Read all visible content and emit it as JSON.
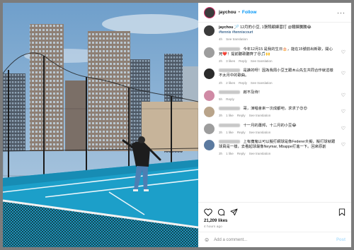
{
  "post": {
    "author": "jaychou",
    "follow_label": "Follow",
    "more_label": "···",
    "caption": "🏸 12月的小豆, 1張照顧練習打 @鐵鍊騰騰😂",
    "hashtag": "#tennis #tenniscourt",
    "caption_age": "4h",
    "see_translation": "See translation"
  },
  "comments": [
    {
      "text": "今年12月15 是我的生日🎂，能在15號前出新歌，開心死❤️！提前聽歌聽齊了😍🎵🙌",
      "age": "2h",
      "likes": "3 likes",
      "reply": "Reply",
      "translate": "See translation"
    },
    {
      "text": "是誰的呀！因為我周小豆王跟木山先生共同合作就這樣不太月中的歌曲。",
      "age": "2h",
      "likes": "2 likes",
      "reply": "Reply",
      "translate": "See translation"
    },
    {
      "text": "啟不及待！",
      "age": "5h",
      "likes": "",
      "reply": "Reply",
      "translate": ""
    },
    {
      "text": "哥，演唱會來一次成都吧，求求了😍😍",
      "age": "3h",
      "likes": "1 like",
      "reply": "Reply",
      "translate": "See translation"
    },
    {
      "text": "十一月的蕭邦，十二月的小豆😂",
      "age": "3h",
      "likes": "1 like",
      "reply": "Reply",
      "translate": "See translation"
    },
    {
      "text": "上有魔鬼以可以擬打網球是像Federer炎擬，擬打球就跟球員是一樣，去看起球最像Neymar, Mbappe打進一下。回來原創",
      "age": "3h",
      "likes": "1 like",
      "reply": "Reply",
      "translate": "See translation"
    }
  ],
  "actions": {
    "likes": "21,209 likes",
    "time_ago": "4 hours ago",
    "add_comment_placeholder": "Add a comment...",
    "post_label": "Post"
  },
  "colors": {
    "accent": "#0095f6",
    "court": "#1c9fc9",
    "sky": "#8fb6d6"
  },
  "icons": [
    "more-icon",
    "heart-icon",
    "comment-icon",
    "share-icon",
    "bookmark-icon",
    "emoji-icon"
  ]
}
